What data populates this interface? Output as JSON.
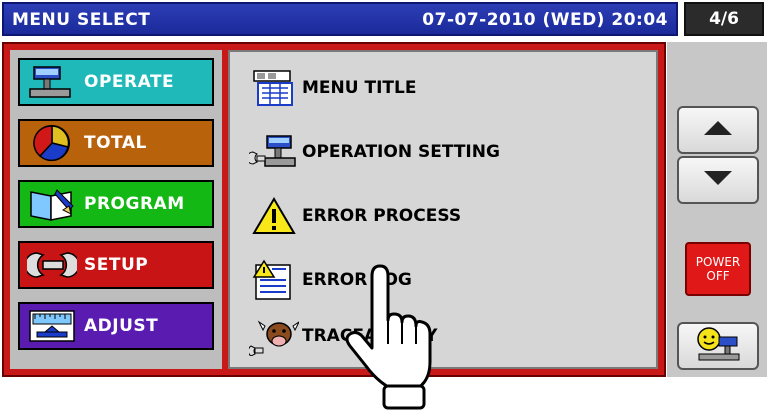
{
  "title_bar": {
    "title": "MENU SELECT",
    "datetime": "07-07-2010 (WED) 20:04",
    "page_indicator": "4/6"
  },
  "categories": [
    {
      "label": "OPERATE",
      "icon": "scale-icon",
      "color": "#1fb9b9"
    },
    {
      "label": "TOTAL",
      "icon": "pie-chart-icon",
      "color": "#b8620b"
    },
    {
      "label": "PROGRAM",
      "icon": "book-icon",
      "color": "#14b814"
    },
    {
      "label": "SETUP",
      "icon": "wrench-icon",
      "color": "#c81414"
    },
    {
      "label": "ADJUST",
      "icon": "gauge-icon",
      "color": "#5a1cb0"
    }
  ],
  "submenu": [
    {
      "label": "MENU TITLE",
      "icon": "menu-title-icon"
    },
    {
      "label": "OPERATION SETTING",
      "icon": "operation-setting-icon"
    },
    {
      "label": "ERROR PROCESS",
      "icon": "warning-icon"
    },
    {
      "label": "ERROR LOG",
      "icon": "error-log-icon"
    },
    {
      "label": "TRACEABILITY",
      "icon": "cow-icon"
    }
  ],
  "right_panel": {
    "scroll_up": "up-arrow-icon",
    "scroll_down": "down-arrow-icon",
    "power_line1": "POWER",
    "power_line2": "OFF",
    "operator_icon": "operator-icon"
  }
}
